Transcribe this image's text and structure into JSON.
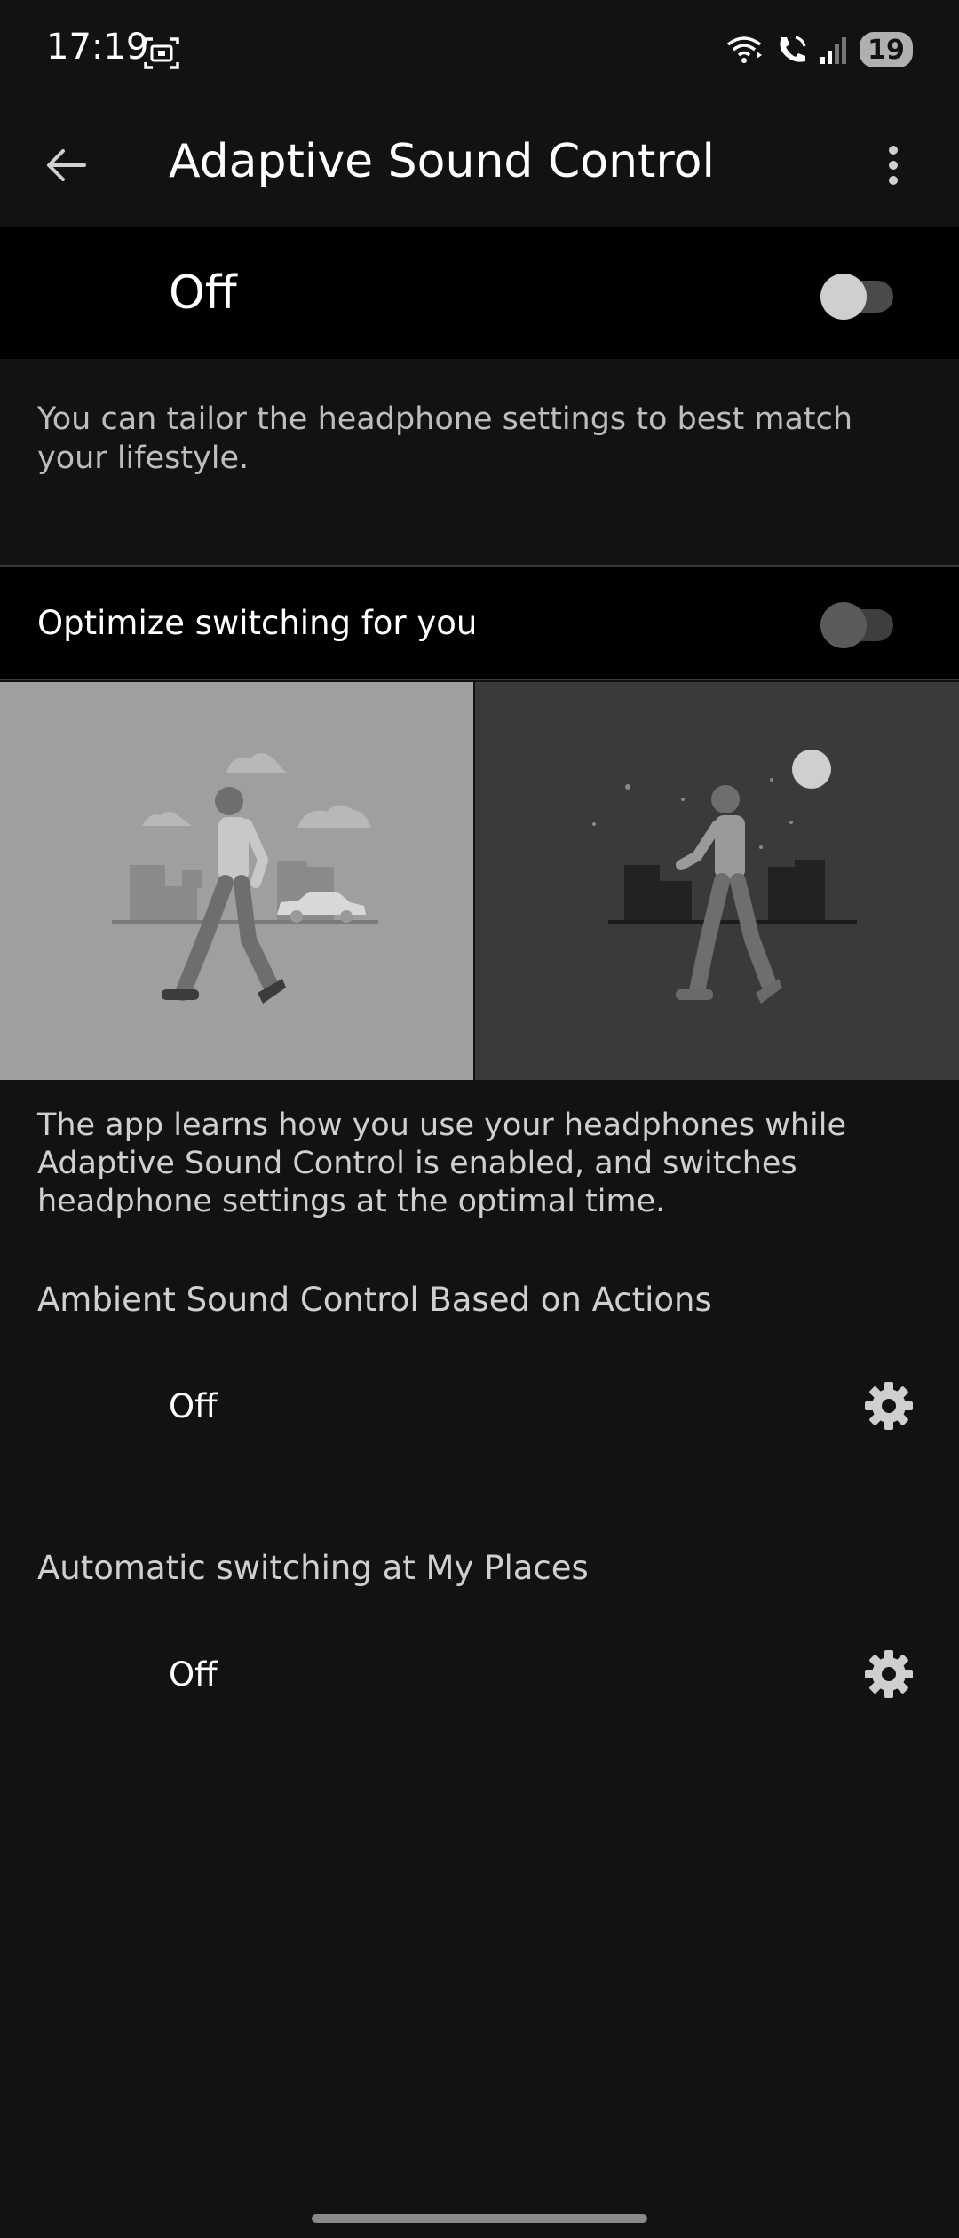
{
  "status_bar": {
    "time": "17:19",
    "battery": "19",
    "icons": [
      "screenshot-icon",
      "wifi-calling-icon",
      "call-icon",
      "signal-icon",
      "battery-icon"
    ]
  },
  "app_bar": {
    "title": "Adaptive Sound Control",
    "back_icon": "arrow-left-icon",
    "menu_icon": "more-vertical-icon"
  },
  "master_switch": {
    "label": "Off",
    "enabled": false
  },
  "description": "You can tailor the headphone settings to best match your lifestyle.",
  "optimize": {
    "label": "Optimize switching for you",
    "enabled": false
  },
  "info_text": "The app learns how you use your headphones while Adaptive Sound Control is enabled, and switches headphone settings at the optimal time.",
  "sections": [
    {
      "title": "Ambient Sound Control Based on Actions",
      "value": "Off",
      "icon": "gear-icon"
    },
    {
      "title": "Automatic switching at My Places",
      "value": "Off",
      "icon": "gear-icon"
    }
  ],
  "colors": {
    "background": "#121212",
    "row_background": "#000000",
    "text_primary": "#ffffff",
    "text_secondary": "#bdbdbd"
  }
}
